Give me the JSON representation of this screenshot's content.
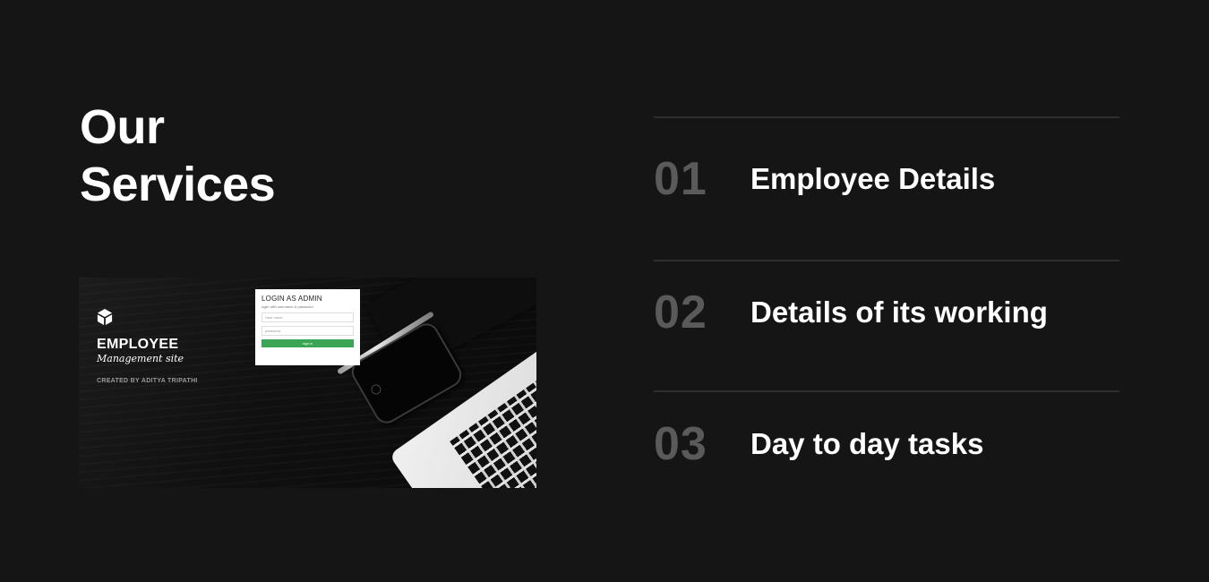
{
  "heading": {
    "line1": "Our",
    "line2": "Services"
  },
  "preview": {
    "logo_icon": "cube-icon",
    "brand": "EMPLOYEE",
    "subbrand": "Management site",
    "credit": "CREATED BY ADITYA TRIPATHI",
    "login": {
      "title": "LOGIN AS ADMIN",
      "hint": "login with username & password",
      "username_placeholder": "User name",
      "password_placeholder": "password",
      "button": "sign in",
      "button_color": "#3aa655"
    }
  },
  "services": [
    {
      "number": "01",
      "title": "Employee Details"
    },
    {
      "number": "02",
      "title": "Details of its working"
    },
    {
      "number": "03",
      "title": "Day to day tasks"
    }
  ],
  "colors": {
    "background": "#151515",
    "heading": "#ffffff",
    "number": "#5a5a5a",
    "divider": "#2f2f2f"
  }
}
